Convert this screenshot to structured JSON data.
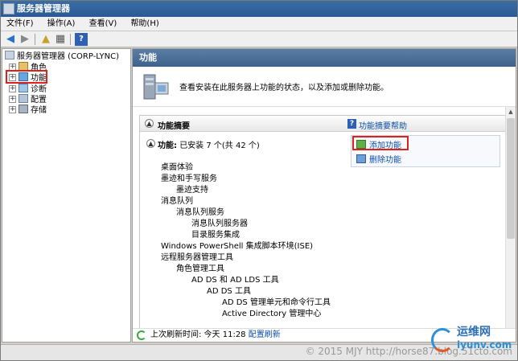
{
  "window": {
    "title": "服务器管理器"
  },
  "menu": [
    "文件(F)",
    "操作(A)",
    "查看(V)",
    "帮助(H)"
  ],
  "tree": {
    "root": "服务器管理器 (CORP-LYNC)",
    "items": [
      {
        "label": "角色",
        "icon": "roles-icon"
      },
      {
        "label": "功能",
        "icon": "features-icon",
        "selected": true
      },
      {
        "label": "诊断",
        "icon": "diagnostics-icon"
      },
      {
        "label": "配置",
        "icon": "configuration-icon"
      },
      {
        "label": "存储",
        "icon": "storage-icon"
      }
    ]
  },
  "main": {
    "header": "功能",
    "description": "查看安装在此服务器上功能的状态，以及添加或删除功能。",
    "section_title": "功能摘要",
    "help_link": "功能摘要帮助",
    "features_label": "功能:",
    "features_status": "已安装 7 个(共 42 个)",
    "actions": {
      "add": "添加功能",
      "remove": "删除功能"
    },
    "features": [
      {
        "text": "桌面体验",
        "level": 0
      },
      {
        "text": "墨迹和手写服务",
        "level": 0
      },
      {
        "text": "墨迹支持",
        "level": 1
      },
      {
        "text": "消息队列",
        "level": 0
      },
      {
        "text": "消息队列服务",
        "level": 1
      },
      {
        "text": "消息队列服务器",
        "level": 2
      },
      {
        "text": "目录服务集成",
        "level": 2
      },
      {
        "text": "Windows PowerShell 集成脚本环境(ISE)",
        "level": 0
      },
      {
        "text": "远程服务器管理工具",
        "level": 0
      },
      {
        "text": "角色管理工具",
        "level": 1
      },
      {
        "text": "AD DS 和 AD LDS 工具",
        "level": 2
      },
      {
        "text": "AD DS 工具",
        "level": 3
      },
      {
        "text": "AD DS 管理单元和命令行工具",
        "level": 4
      },
      {
        "text": "Active Directory 管理中心",
        "level": 4
      }
    ],
    "last_refresh_label": "上次刷新时间: 今天 11:28",
    "refresh_link": "配置刷新"
  },
  "watermark": "© 2015 MJY http://horse87.blog.51cto.com",
  "logo": {
    "line1": "运维网",
    "line2": "iyunv.com"
  },
  "colors": {
    "accent": "#3d628c",
    "link": "#0a4fa8",
    "highlight": "#e0201c"
  }
}
